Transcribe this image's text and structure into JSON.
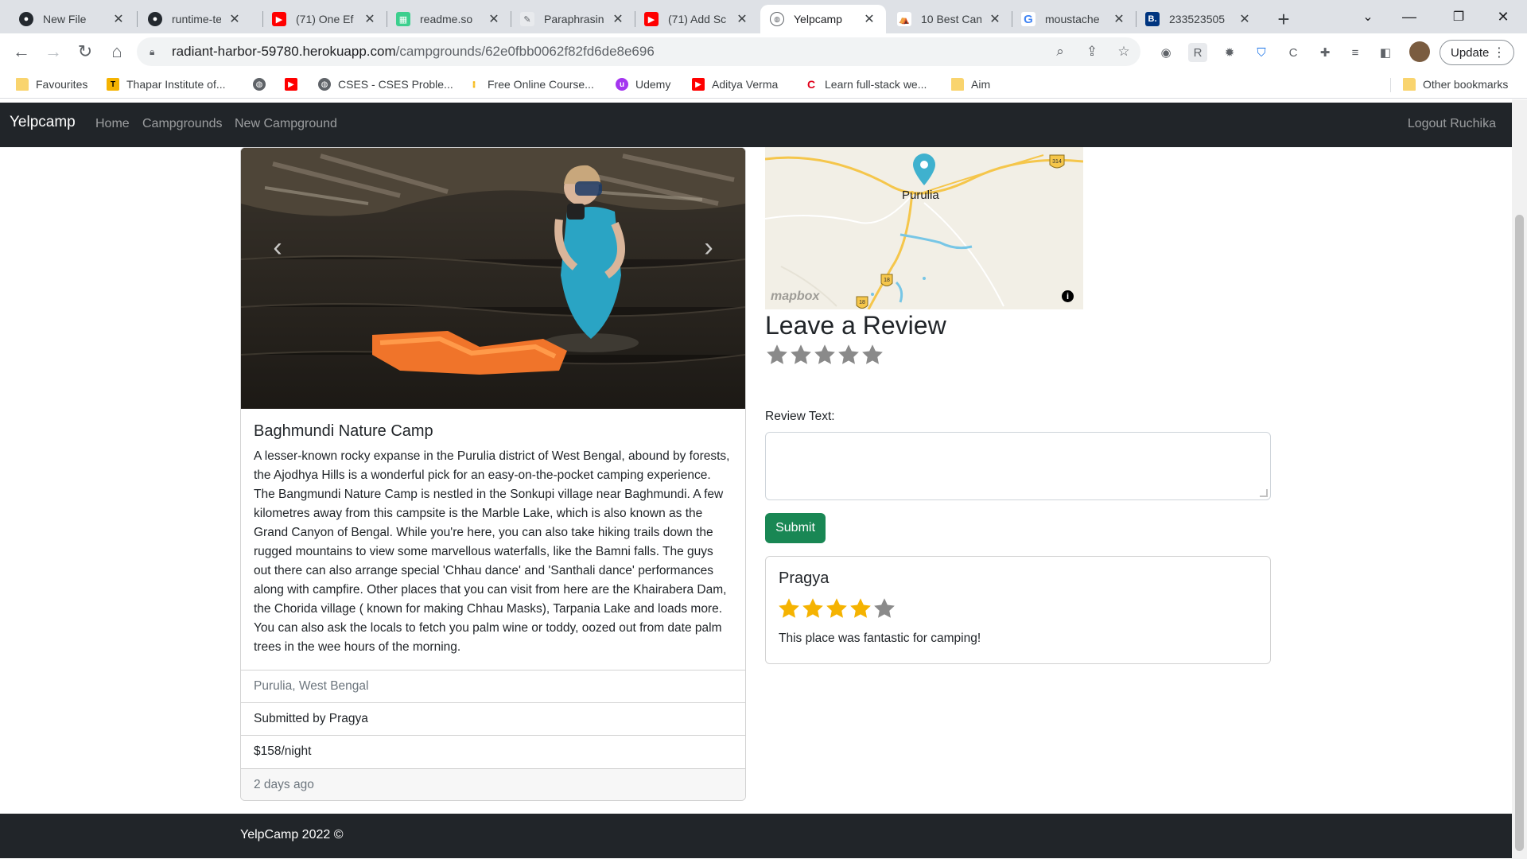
{
  "browser": {
    "tabs": [
      {
        "title": "New File",
        "icon": "github-icon"
      },
      {
        "title": "runtime-ter",
        "icon": "github-icon"
      },
      {
        "title": "(71) One Ef",
        "icon": "youtube-icon"
      },
      {
        "title": "readme.so",
        "icon": "readme-icon"
      },
      {
        "title": "Paraphrasin",
        "icon": "quill-icon"
      },
      {
        "title": "(71) Add Sc",
        "icon": "youtube-icon"
      },
      {
        "title": "Yelpcamp",
        "icon": "globe-icon",
        "active": true
      },
      {
        "title": "10 Best Can",
        "icon": "site-icon"
      },
      {
        "title": "moustache",
        "icon": "google-icon"
      },
      {
        "title": "233523505",
        "icon": "booking-icon"
      }
    ],
    "url_host": "radiant-harbor-59780.herokuapp.com",
    "url_path": "/campgrounds/62e0fbb0062f82fd6de8e696",
    "update_label": "Update",
    "bookmarks": [
      {
        "label": "Favourites",
        "icon": "folder-icon"
      },
      {
        "label": "Thapar Institute of...",
        "icon": "thapar-icon"
      },
      {
        "label": "",
        "icon": "globe-icon"
      },
      {
        "label": "",
        "icon": "youtube-icon"
      },
      {
        "label": "CSES - CSES Proble...",
        "icon": "globe-icon"
      },
      {
        "label": "Free Online Course...",
        "icon": "course-icon"
      },
      {
        "label": "Udemy",
        "icon": "udemy-icon"
      },
      {
        "label": "Aditya Verma",
        "icon": "youtube-icon"
      },
      {
        "label": "Learn full-stack we...",
        "icon": "codecademy-icon"
      },
      {
        "label": "Aim",
        "icon": "folder-icon"
      }
    ],
    "other_bookmarks": "Other bookmarks"
  },
  "site": {
    "brand": "Yelpcamp",
    "nav": [
      "Home",
      "Campgrounds",
      "New Campground"
    ],
    "logout": "Logout Ruchika"
  },
  "campground": {
    "title": "Baghmundi Nature Camp",
    "description": "A lesser-known rocky expanse in the Purulia district of West Bengal, abound by forests, the Ajodhya Hills is a wonderful pick for an easy-on-the-pocket camping experience. The Bangmundi Nature Camp is nestled in the Sonkupi village near Baghmundi. A few kilometres away from this campsite is the Marble Lake, which is also known as the Grand Canyon of Bengal. While you're here, you can also take hiking trails down the rugged mountains to view some marvellous waterfalls, like the Bamni falls. The guys out there can also arrange special 'Chhau dance' and 'Santhali dance' performances along with campfire. Other places that you can visit from here are the Khairabera Dam, the Chorida village ( known for making Chhau Masks), Tarpania Lake and loads more. You can also ask the locals to fetch you palm wine or toddy, oozed out from date palm trees in the wee hours of the morning.",
    "location": "Purulia, West Bengal",
    "submitted_by": "Submitted by Pragya",
    "price": "$158/night",
    "posted": "2 days ago"
  },
  "map": {
    "place_label": "Purulia",
    "attribution": "mapbox",
    "road_shields": [
      "314",
      "18",
      "18"
    ]
  },
  "review_form": {
    "heading": "Leave a Review",
    "rating": 0,
    "text_label": "Review Text:",
    "text_value": "",
    "submit_label": "Submit"
  },
  "reviews": [
    {
      "author": "Pragya",
      "rating": 4,
      "text": "This place was fantastic for camping!"
    }
  ],
  "footer": {
    "text": "YelpCamp 2022 ©"
  },
  "colors": {
    "navbar": "#212529",
    "submit": "#198754",
    "star_filled": "#f5b301",
    "star_empty": "#8a8a8a"
  }
}
